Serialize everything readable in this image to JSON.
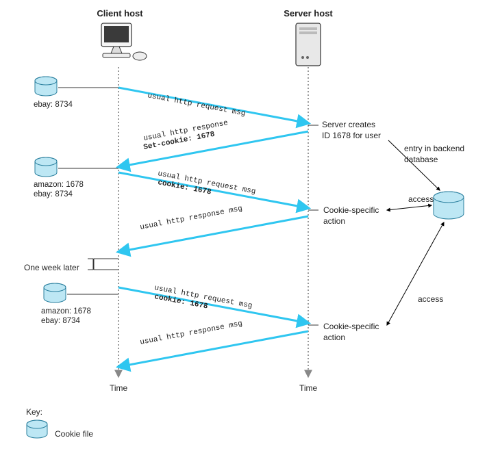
{
  "headers": {
    "client": "Client host",
    "server": "Server host"
  },
  "cookies": {
    "c1": "ebay: 8734",
    "c2_l1": "amazon: 1678",
    "c2_l2": "ebay: 8734",
    "c3_l1": "amazon: 1678",
    "c3_l2": "ebay: 8734"
  },
  "msgs": {
    "m1": "usual http request msg",
    "m2a": "usual http response",
    "m2b": "Set-cookie: 1678",
    "m3a": "usual http request msg",
    "m3b": "cookie: 1678",
    "m4": "usual http response msg",
    "m5a": "usual http request msg",
    "m5b": "cookie: 1678",
    "m6": "usual http response msg"
  },
  "annots": {
    "create_l1": "Server creates",
    "create_l2": "ID 1678 for user",
    "backend_l1": "entry in backend",
    "backend_l2": "database",
    "csa1": "Cookie-specific",
    "csa1b": "action",
    "csa2": "Cookie-specific",
    "csa2b": "action",
    "access1": "access",
    "access2": "access",
    "week": "One week later",
    "time": "Time",
    "key": "Key:",
    "keylabel": "Cookie file"
  }
}
